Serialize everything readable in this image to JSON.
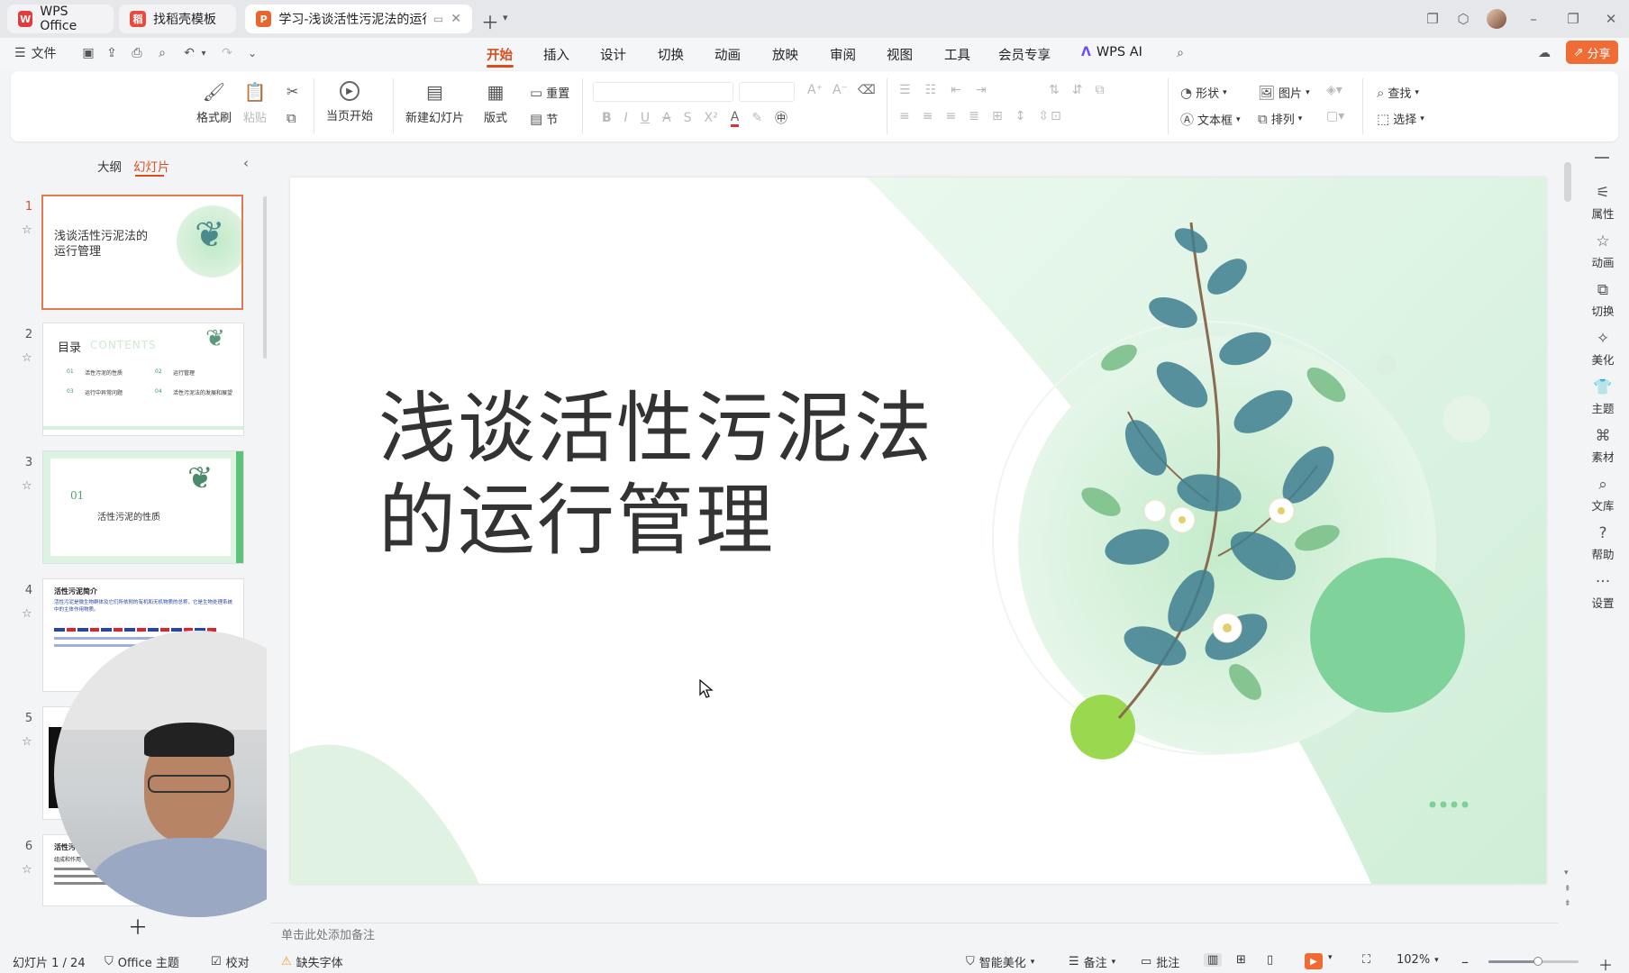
{
  "tabs": [
    {
      "label": "WPS Office"
    },
    {
      "label": "找稻壳模板"
    },
    {
      "label": "学习-浅谈活性污泥法的运行管"
    }
  ],
  "menu": {
    "file_label": "文件",
    "tabs": [
      "开始",
      "插入",
      "设计",
      "切换",
      "动画",
      "放映",
      "审阅",
      "视图",
      "工具",
      "会员专享",
      "WPS AI"
    ],
    "share_label": "分享"
  },
  "ribbon": {
    "format_painter": "格式刷",
    "paste": "粘贴",
    "play_from_current": "当页开始",
    "new_slide": "新建幻灯片",
    "layout": "版式",
    "reset": "重置",
    "section": "节",
    "shape": "形状",
    "picture": "图片",
    "textbox": "文本框",
    "arrange": "排列",
    "find": "查找",
    "select": "选择"
  },
  "panel": {
    "outline_tab": "大纲",
    "slides_tab": "幻灯片"
  },
  "thumbnails": {
    "t1_title": "浅谈活性污泥法的运行管理",
    "t2_title": "目录",
    "t2_sub": "CONTENTS",
    "t2_items": [
      "01",
      "活性污泥的性质",
      "02",
      "运行管理",
      "03",
      "运行中异常问题",
      "04",
      "活性污泥法的发展和展望"
    ],
    "t3_num": "01",
    "t3_title": "活性污泥的性质",
    "t4_title": "活性污泥简介",
    "t4_body": "活性污泥是微生物群体及它们所依附的有机和无机物质的总称，它是生物处理系统中的主体作用物质。",
    "t6_title": "活性污泥",
    "t6_sub": "组成和作用"
  },
  "slide_numbers": [
    "1",
    "2",
    "3",
    "4",
    "5",
    "6"
  ],
  "slide": {
    "title_line1": "浅谈活性污泥法",
    "title_line2": "的运行管理"
  },
  "notes_placeholder": "单击此处添加备注",
  "rightbar": [
    "属性",
    "动画",
    "切换",
    "美化",
    "主题",
    "素材",
    "文库",
    "帮助",
    "设置"
  ],
  "status": {
    "slide_counter": "幻灯片 1 / 24",
    "theme": "Office 主题",
    "proof": "校对",
    "missing_font": "缺失字体",
    "smart_beautify": "智能美化",
    "notes": "备注",
    "comments": "批注",
    "zoom": "102%"
  },
  "colors": {
    "accent": "#d94e1f",
    "slide_green": "#7fd29a",
    "lime": "#9ad94f"
  }
}
